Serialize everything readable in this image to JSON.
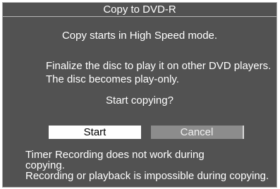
{
  "dialog": {
    "title": "Copy to DVD-R",
    "mode_line": "Copy starts in High Speed mode.",
    "finalize_line_1": "Finalize the disc to play it on other DVD players.",
    "finalize_line_2": "The disc becomes play-only.",
    "question": "Start copying?",
    "start_label": "Start",
    "cancel_label": "Cancel",
    "footer_line_1": "Timer Recording does not work during",
    "footer_line_2": "copying.",
    "footer_line_3": "Recording or playback is impossible during copying."
  },
  "colors": {
    "background": "#525252",
    "selected_button": "#ffffff",
    "unselected_button": "#8c8c8c",
    "text": "#ffffff"
  }
}
